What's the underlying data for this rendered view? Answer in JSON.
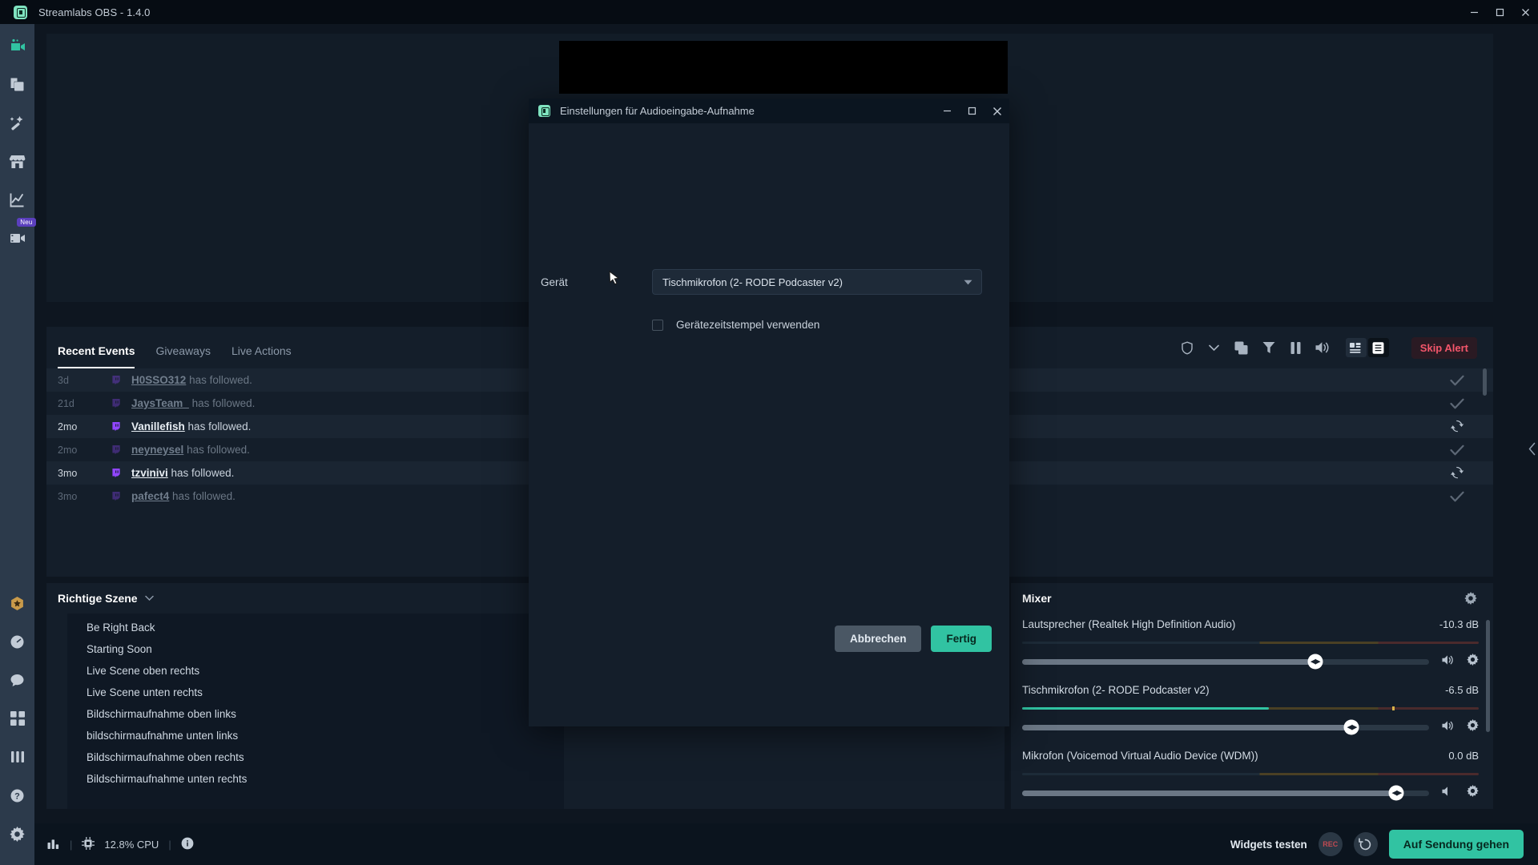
{
  "window": {
    "title": "Streamlabs OBS - 1.4.0",
    "logo_icon": "streamlabs-logo-icon",
    "minimize": "–",
    "maximize": "▫",
    "close": "✕"
  },
  "rail": {
    "top_items": [
      {
        "name": "editor",
        "icon": "video-camera-icon",
        "active": true
      },
      {
        "name": "themes",
        "icon": "layers-icon",
        "active": false
      },
      {
        "name": "alertbox",
        "icon": "magic-wand-icon",
        "active": false
      },
      {
        "name": "store",
        "icon": "store-icon",
        "active": false
      },
      {
        "name": "dashboard",
        "icon": "chart-line-icon",
        "active": false
      },
      {
        "name": "highlighter",
        "icon": "film-icon",
        "active": false,
        "badge": "Neu"
      }
    ],
    "bottom_items": [
      {
        "name": "prime",
        "icon": "prime-badge-icon"
      },
      {
        "name": "moon",
        "icon": "moon-icon"
      },
      {
        "name": "chat",
        "icon": "chat-bubble-icon"
      },
      {
        "name": "layout",
        "icon": "grid-icon"
      },
      {
        "name": "columns",
        "icon": "columns-icon"
      },
      {
        "name": "help",
        "icon": "question-circle-icon"
      },
      {
        "name": "settings",
        "icon": "gear-icon"
      }
    ]
  },
  "events": {
    "tabs": [
      {
        "label": "Recent Events",
        "active": true
      },
      {
        "label": "Giveaways",
        "active": false
      },
      {
        "label": "Live Actions",
        "active": false
      }
    ],
    "tools": [
      {
        "name": "shield-icon"
      },
      {
        "name": "chevron-down-icon"
      },
      {
        "name": "copy-icon"
      },
      {
        "name": "filter-icon"
      },
      {
        "name": "pause-icon"
      },
      {
        "name": "speaker-icon"
      }
    ],
    "view_toggles": [
      {
        "name": "compact-view-icon",
        "selected": false
      },
      {
        "name": "list-view-icon",
        "selected": true
      }
    ],
    "skip_alert_label": "Skip Alert",
    "rows": [
      {
        "time": "3d",
        "user": "H0SSO312",
        "text": "has followed.",
        "action": "check-icon",
        "dim": true,
        "light": true
      },
      {
        "time": "21d",
        "user": "JaysTeam_",
        "text": "has followed.",
        "action": "check-icon",
        "dim": true,
        "light": false
      },
      {
        "time": "2mo",
        "user": "Vanillefish",
        "text": "has followed.",
        "action": "refresh-icon",
        "dim": false,
        "light": true
      },
      {
        "time": "2mo",
        "user": "neyneysel",
        "text": "has followed.",
        "action": "check-icon",
        "dim": true,
        "light": false
      },
      {
        "time": "3mo",
        "user": "tzvinivi",
        "text": "has followed.",
        "action": "refresh-icon",
        "dim": false,
        "light": true
      },
      {
        "time": "3mo",
        "user": "pafect4",
        "text": "has followed.",
        "action": "check-icon",
        "dim": true,
        "light": false
      }
    ]
  },
  "scenes": {
    "title": "Richtige Szene",
    "caret_icon": "chevron-down-icon",
    "actions": [
      {
        "name": "add-scene-icon",
        "glyph": "＋"
      },
      {
        "name": "remove-scene-icon",
        "glyph": "−"
      },
      {
        "name": "scene-settings-icon",
        "glyph": "gear"
      }
    ],
    "items": [
      "Be Right Back",
      "Starting Soon",
      "Live Scene oben rechts",
      "Live Scene unten rechts",
      "Bildschirmaufnahme oben links",
      "bildschirmaufnahme unten links",
      "Bildschirmaufnahme oben rechts",
      "Bildschirmaufnahme unten rechts"
    ]
  },
  "mixer": {
    "title": "Mixer",
    "gear_icon": "gear-icon",
    "channels": [
      {
        "name": "Lautsprecher (Realtek High Definition Audio)",
        "db": "-10.3 dB",
        "meter_fill_pct": 0,
        "peak_pct": 0,
        "slider_pct": 72,
        "mute_icon": "speaker-icon",
        "settings_icon": "gear-icon"
      },
      {
        "name": "Tischmikrofon (2- RODE Podcaster v2)",
        "db": "-6.5 dB",
        "meter_fill_pct": 54,
        "peak_pct": 81,
        "slider_pct": 81,
        "mute_icon": "speaker-icon",
        "settings_icon": "gear-icon"
      },
      {
        "name": "Mikrofon (Voicemod Virtual Audio Device (WDM))",
        "db": "0.0 dB",
        "meter_fill_pct": 0,
        "peak_pct": 0,
        "slider_pct": 92,
        "mute_icon": "speaker-icon",
        "settings_icon": "gear-icon"
      }
    ]
  },
  "statusbar": {
    "performance_icon": "bar-chart-icon",
    "cpu_icon": "cpu-icon",
    "cpu_text": "12.8% CPU",
    "info_icon": "info-icon",
    "separator": "|",
    "widgets_label": "Widgets testen",
    "rec_label": "REC",
    "replay_icon": "replay-icon",
    "golive_label": "Auf Sendung gehen"
  },
  "dialog": {
    "title": "Einstellungen für Audioeingabe-Aufnahme",
    "logo_icon": "streamlabs-logo-icon",
    "minimize": "–",
    "maximize": "▫",
    "close": "✕",
    "device_label": "Gerät",
    "device_value": "Tischmikrofon (2- RODE Podcaster v2)",
    "device_caret_icon": "chevron-down-icon",
    "checkbox_label": "Gerätezeitstempel verwenden",
    "checkbox_checked": false,
    "cancel_label": "Abbrechen",
    "done_label": "Fertig"
  },
  "colors": {
    "accent": "#31c3a2",
    "panel": "#141e2a",
    "rail": "#2c3a4b",
    "danger": "#f4566b",
    "twitch": "#9146ff"
  }
}
